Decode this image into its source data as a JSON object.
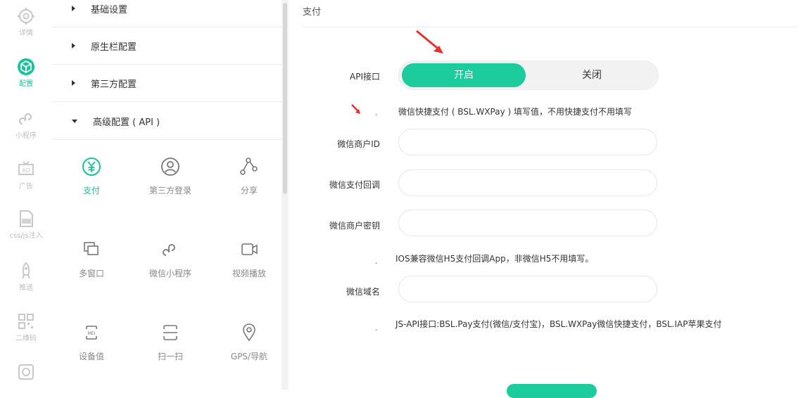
{
  "rail": {
    "items": [
      {
        "label": "详情",
        "icon": "gear-icon"
      },
      {
        "label": "配置",
        "icon": "cube-icon",
        "active": true
      },
      {
        "label": "小程序",
        "icon": "mini-program-icon"
      },
      {
        "label": "广告",
        "icon": "ad-icon"
      },
      {
        "label": "css/js注入",
        "icon": "code-file-icon"
      },
      {
        "label": "推送",
        "icon": "rocket-icon"
      },
      {
        "label": "二维码",
        "icon": "qrcode-icon"
      },
      {
        "label": "",
        "icon": "download-icon"
      }
    ]
  },
  "menu": {
    "items": [
      {
        "label": "基础设置"
      },
      {
        "label": "原生栏配置"
      },
      {
        "label": "第三方配置"
      },
      {
        "label": "高级配置 ( API )"
      }
    ]
  },
  "grid": {
    "items": [
      {
        "label": "支付",
        "icon": "yuan-circle-icon",
        "active": true
      },
      {
        "label": "第三方登录",
        "icon": "user-circle-icon"
      },
      {
        "label": "分享",
        "icon": "share-icon"
      },
      {
        "label": "多窗口",
        "icon": "windows-icon"
      },
      {
        "label": "微信小程序",
        "icon": "mini-program-icon"
      },
      {
        "label": "视频播放",
        "icon": "video-icon"
      },
      {
        "label": "设备值",
        "icon": "device-icon"
      },
      {
        "label": "扫一扫",
        "icon": "scan-icon"
      },
      {
        "label": "GPS/导航",
        "icon": "location-pin-icon"
      }
    ]
  },
  "content": {
    "title": "支付",
    "api_label": "API接口",
    "toggle_on": "开启",
    "toggle_off": "关闭",
    "hint_wxpay": "微信快捷支付 ( BSL.WXPay ) 填写值，不用快捷支付不用填写",
    "merchant_id_label": "微信商户ID",
    "callback_label": "微信支付回调",
    "secret_label": "微信商户密钥",
    "hint_ios": "IOS兼容微信H5支付回调App，非微信H5不用填写。",
    "domain_label": "微信域名",
    "hint_jsapi": "JS-API接口:BSL.Pay支付(微信/支付宝)，BSL.WXPay微信快捷支付，BSL.IAP苹果支付",
    "dash": "-"
  },
  "colors": {
    "accent": "#1dcc9c",
    "arrow": "#e8302f"
  }
}
